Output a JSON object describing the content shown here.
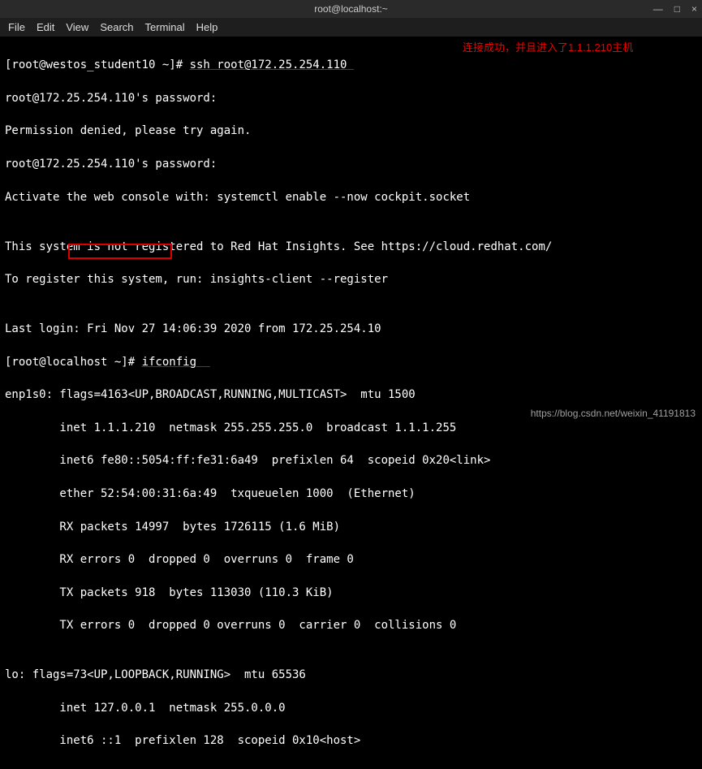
{
  "window": {
    "title": "root@localhost:~",
    "minimize": "—",
    "maximize": "□",
    "close": "×"
  },
  "menu": {
    "file": "File",
    "edit": "Edit",
    "view": "View",
    "search": "Search",
    "terminal": "Terminal",
    "help": "Help"
  },
  "annotation": "连接成功，并且进入了1.1.1.210主机",
  "lines": {
    "l1a": "[root@westos_student10 ~]# ",
    "l1b": "ssh root@172.25.254.110 ",
    "l2": "root@172.25.254.110's password: ",
    "l3": "Permission denied, please try again.",
    "l4": "root@172.25.254.110's password: ",
    "l5": "Activate the web console with: systemctl enable --now cockpit.socket",
    "l6": "",
    "l7": "This system is not registered to Red Hat Insights. See https://cloud.redhat.com/",
    "l8": "To register this system, run: insights-client --register",
    "l9": "",
    "l10": "Last login: Fri Nov 27 14:06:39 2020 from 172.25.254.10",
    "l11a": "[root@localhost ~]# ",
    "l11b": "ifconfig  ",
    "l12": "enp1s0: flags=4163<UP,BROADCAST,RUNNING,MULTICAST>  mtu 1500",
    "l13": "        inet 1.1.1.210  netmask 255.255.255.0  broadcast 1.1.1.255",
    "l14": "        inet6 fe80::5054:ff:fe31:6a49  prefixlen 64  scopeid 0x20<link>",
    "l15": "        ether 52:54:00:31:6a:49  txqueuelen 1000  (Ethernet)",
    "l16": "        RX packets 14997  bytes 1726115 (1.6 MiB)",
    "l17": "        RX errors 0  dropped 0  overruns 0  frame 0",
    "l18": "        TX packets 918  bytes 113030 (110.3 KiB)",
    "l19": "        TX errors 0  dropped 0 overruns 0  carrier 0  collisions 0",
    "l20": "",
    "l21": "lo: flags=73<UP,LOOPBACK,RUNNING>  mtu 65536",
    "l22": "        inet 127.0.0.1  netmask 255.0.0.0",
    "l23": "        inet6 ::1  prefixlen 128  scopeid 0x10<host>"
  },
  "watermark": "https://blog.csdn.net/weixin_41191813"
}
